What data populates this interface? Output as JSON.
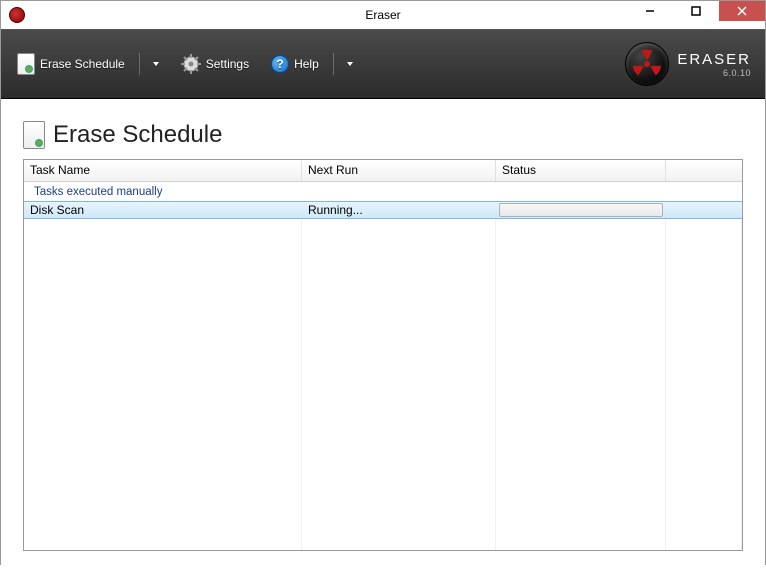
{
  "window": {
    "title": "Eraser"
  },
  "toolbar": {
    "erase_schedule": "Erase Schedule",
    "settings": "Settings",
    "help": "Help"
  },
  "brand": {
    "name": "ERASER",
    "version": "6.0.10"
  },
  "page": {
    "title": "Erase Schedule"
  },
  "columns": {
    "task_name": "Task Name",
    "next_run": "Next Run",
    "status": "Status"
  },
  "group": {
    "label": "Tasks executed manually"
  },
  "rows": [
    {
      "task_name": "Disk Scan",
      "next_run": "Running...",
      "status": ""
    }
  ]
}
